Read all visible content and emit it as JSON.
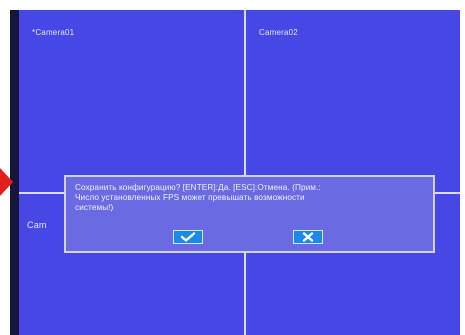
{
  "monitor": {
    "tiles": [
      {
        "label": "*Camera01"
      },
      {
        "label": "Camera02"
      },
      {
        "label": "Cam"
      },
      {
        "label": ""
      }
    ]
  },
  "dialog": {
    "lines": [
      "Сохранить конфигурацию? [ENTER]:Да. [ESC]:Отмена. (Прим.:",
      "Число установленных FPS может превышать возможности",
      "системы!)"
    ],
    "ok_icon": "checkmark-icon",
    "cancel_icon": "cross-icon"
  },
  "colors": {
    "screen_bg": "#4747e6",
    "dialog_bg": "#6a6ae3",
    "button_bg": "#1b89e8",
    "arrow": "#e0201b",
    "grid": "#dcdcf5"
  }
}
